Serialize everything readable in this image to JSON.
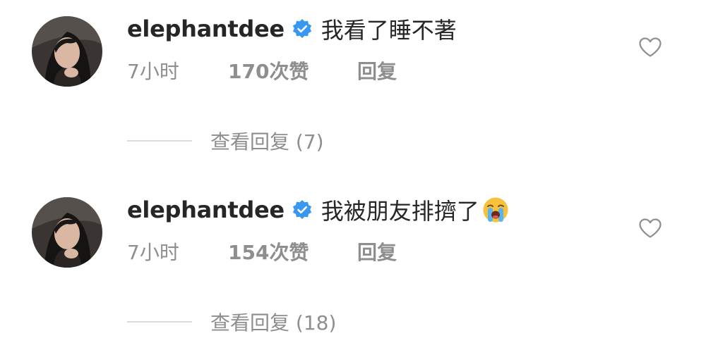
{
  "comments": [
    {
      "username": "elephantdee",
      "text": "我看了睡不著",
      "has_emoji": false,
      "time": "7小时",
      "likes": "170次赞",
      "reply": "回复",
      "view_replies": "查看回复 (7)"
    },
    {
      "username": "elephantdee",
      "text": "我被朋友排擠了",
      "has_emoji": true,
      "emoji_name": "loudly-crying-face-emoji",
      "time": "7小时",
      "likes": "154次赞",
      "reply": "回复",
      "view_replies": "查看回复 (18)"
    }
  ],
  "colors": {
    "text_primary": "#262626",
    "text_secondary": "#8e8e8e",
    "verified_blue": "#3897f0",
    "divider": "#dbdbdb"
  },
  "icons": {
    "verified": "verified-badge-icon",
    "like": "heart-outline-icon"
  }
}
